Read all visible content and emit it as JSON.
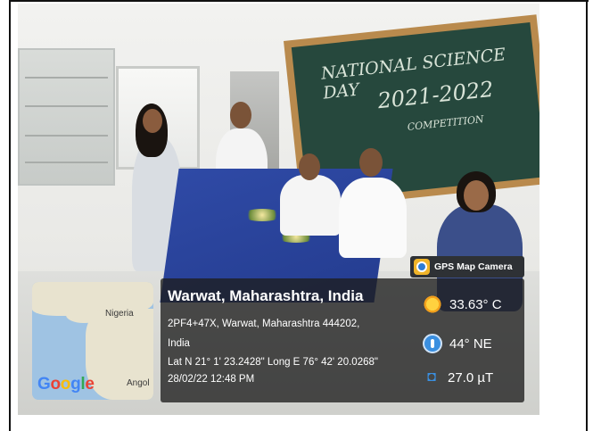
{
  "overlay": {
    "badge_label": "GPS Map Camera",
    "location_title": "Warwat, Maharashtra, India",
    "address_line1": "2PF4+47X, Warwat, Maharashtra 444202,",
    "address_line2": "India",
    "coordinates": "Lat N 21° 1' 23.2428\" Long E 76° 42' 20.0268\"",
    "datetime": "28/02/22 12:48 PM",
    "temperature": "33.63° C",
    "wind": "44° NE",
    "magnetic_field": "27.0 µT"
  },
  "map": {
    "label_nigeria": "Nigeria",
    "label_angola": "Angol",
    "google_letters": [
      "G",
      "o",
      "o",
      "g",
      "l",
      "e"
    ],
    "google_colors": [
      "#4285F4",
      "#EA4335",
      "#FBBC05",
      "#4285F4",
      "#34A853",
      "#EA4335"
    ]
  },
  "board": {
    "line1": "NATIONAL SCIENCE DAY",
    "line2": "2021-2022",
    "line3": "COMPETITION"
  },
  "icons": {
    "temperature": "sun-icon",
    "wind": "compass-icon",
    "magnetic": "magnet-icon",
    "badge": "gps-map-camera-logo-icon"
  }
}
